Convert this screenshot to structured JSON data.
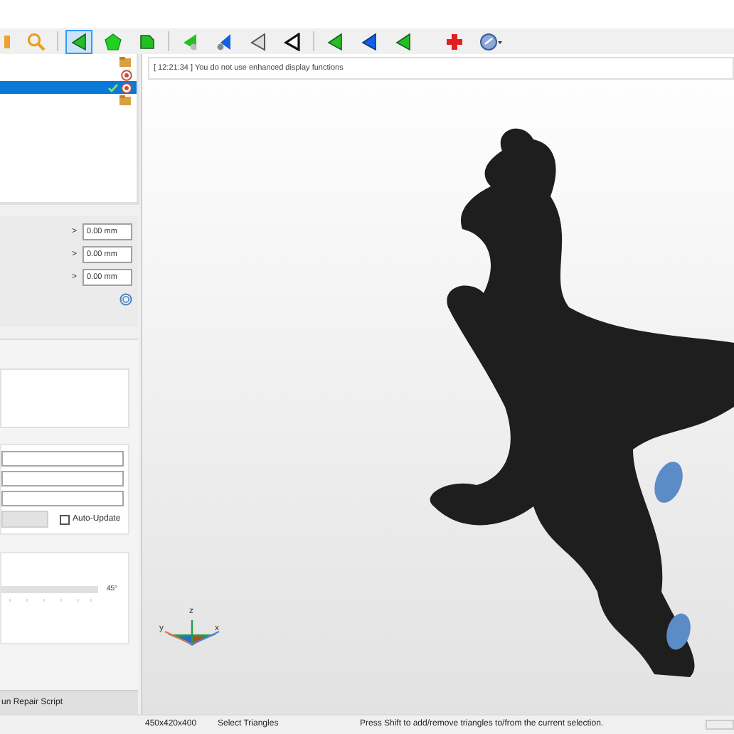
{
  "toolbar": [
    [
      {
        "kind": "orange-tool",
        "selected": false
      },
      {
        "kind": "magnifier",
        "selected": false
      }
    ],
    [
      {
        "kind": "green-triangle",
        "selected": true
      },
      {
        "kind": "green-pentagon",
        "selected": false
      },
      {
        "kind": "green-square",
        "selected": false
      }
    ],
    [
      {
        "kind": "green-triangle-dot",
        "selected": false
      },
      {
        "kind": "blue-triangle-dot",
        "selected": false
      },
      {
        "kind": "grey-triangle",
        "selected": false
      },
      {
        "kind": "black-triangle",
        "selected": false
      }
    ],
    [
      {
        "kind": "green-triangle",
        "selected": false
      },
      {
        "kind": "blue-triangle",
        "selected": false
      },
      {
        "kind": "green-triangle",
        "selected": false
      },
      {
        "kind": "red-cross",
        "selected": false
      },
      {
        "kind": "blue-disc",
        "selected": false
      }
    ]
  ],
  "tree": {
    "rows": [
      {
        "kind": "folder",
        "selected": false,
        "checked": false
      },
      {
        "kind": "target",
        "selected": false,
        "checked": false
      },
      {
        "kind": "target",
        "selected": true,
        "checked": true
      },
      {
        "kind": "folder",
        "selected": false,
        "checked": false
      }
    ]
  },
  "offsets": [
    {
      "arrow": ">",
      "value": "0.00 mm"
    },
    {
      "arrow": ">",
      "value": "0.00 mm"
    },
    {
      "arrow": ">",
      "value": "0.00 mm"
    }
  ],
  "auto_update": {
    "label": "Auto-Update",
    "checked": false
  },
  "angle": {
    "reading": "45°"
  },
  "run_button": "un Repair Script",
  "message": "[ 12:21:34 ] You do not use enhanced display functions",
  "axes": {
    "x": "x",
    "y": "y",
    "z": "z"
  },
  "status_bar": [
    "450x420x400",
    "Select Triangles",
    "Press Shift to add/remove triangles to/from the current selection."
  ]
}
